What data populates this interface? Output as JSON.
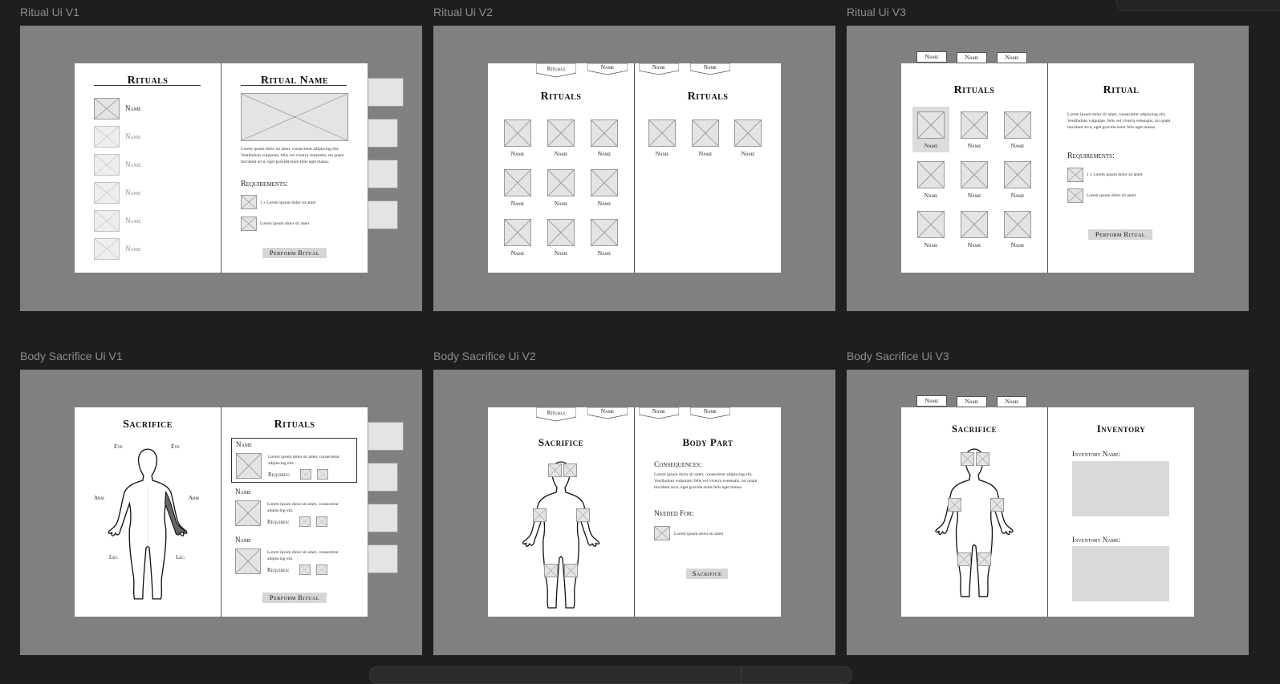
{
  "frames": {
    "ritual_v1": {
      "label": "Ritual Ui V1"
    },
    "ritual_v2": {
      "label": "Ritual Ui V2"
    },
    "ritual_v3": {
      "label": "Ritual Ui V3"
    },
    "sacrifice_v1": {
      "label": "Body Sacrifice Ui V1"
    },
    "sacrifice_v2": {
      "label": "Body Sacrifice Ui V2"
    },
    "sacrifice_v3": {
      "label": "Body Sacrifice Ui V3"
    }
  },
  "common": {
    "name": "Name",
    "rituals": "Rituals",
    "ritual": "Ritual",
    "ritual_name": "Ritual Name",
    "sacrifice": "Sacrifice",
    "inventory": "Inventory",
    "body_part": "Body Part",
    "requirements": "Requirements:",
    "requires": "Requires:",
    "consequences": "Consequences:",
    "needed_for": "Needed For:",
    "inventory_name": "Inventory Name:",
    "perform_ritual": "Perform Ritual",
    "sacrifice_button": "Sacrifice",
    "lorem_long": "Lorem ipsum dolor sit amet, consectetur adipiscing elit. Vestibulum vulputate, felis vel viverra venenatis, mi quam tincidunt arcu, eget gravida enim felis eget massa.",
    "lorem_short": "Lorem ipsum dolor sit amet, consectetur adipiscing elit.",
    "req_1": "1 x Lorem ipsum dolor sit amet",
    "req_2": "Lorem ipsum dolor sit amet",
    "eye": "Eye",
    "arm": "Arm",
    "leg": "Leg"
  }
}
